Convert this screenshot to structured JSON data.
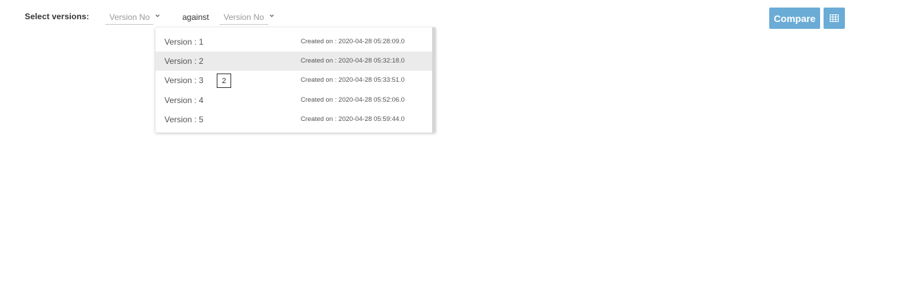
{
  "toolbar": {
    "select_label": "Select versions:",
    "select_a": {
      "placeholder": "Version No"
    },
    "against_label": "against",
    "select_b": {
      "placeholder": "Version No"
    },
    "compare_label": "Compare",
    "grid_icon": "table-grid-icon",
    "accent_color": "#6aacd6"
  },
  "dropdown": {
    "options": [
      {
        "label": "Version : 1",
        "created": "Created on : 2020-04-28 05:28:09.0"
      },
      {
        "label": "Version : 2",
        "created": "Created on : 2020-04-28 05:32:18.0"
      },
      {
        "label": "Version : 3",
        "created": "Created on : 2020-04-28 05:33:51.0"
      },
      {
        "label": "Version : 4",
        "created": "Created on : 2020-04-28 05:52:06.0"
      },
      {
        "label": "Version : 5",
        "created": "Created on : 2020-04-28 05:59:44.0"
      }
    ],
    "highlighted_index": 1,
    "badge": "2"
  }
}
